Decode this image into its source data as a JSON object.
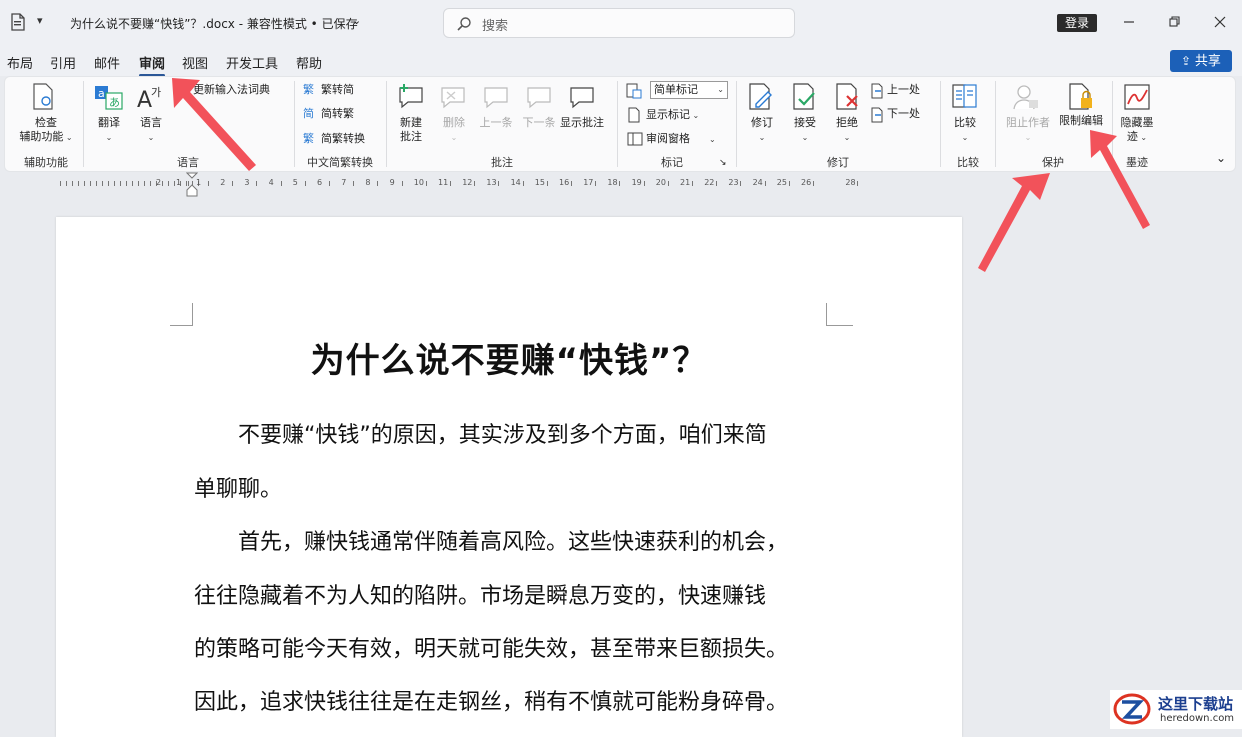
{
  "titlebar": {
    "doc_title": "为什么说不要赚“快钱”？.docx  -  兼容性模式 • 已保存",
    "search_placeholder": "搜索",
    "login_label": "登录"
  },
  "menu": {
    "tabs": [
      "布局",
      "引用",
      "邮件",
      "审阅",
      "视图",
      "开发工具",
      "帮助"
    ],
    "active": "审阅",
    "share_label": "共享"
  },
  "ribbon": {
    "groups": {
      "accessibility": "辅助功能",
      "language": "语言",
      "chinese_conv": "中文简繁转换",
      "comments": "批注",
      "tracking": "标记",
      "changes": "修订",
      "compare": "比较",
      "protect": "保护",
      "ink": "墨迹"
    },
    "buttons": {
      "check_line1": "检查",
      "check_line2": "辅助功能",
      "translate": "翻译",
      "language": "语言",
      "update_ime": "更新输入法词典",
      "trad_to_simp": "繁转简",
      "simp_to_trad": "简转繁",
      "conv": "简繁转换",
      "new_comment_1": "新建",
      "new_comment_2": "批注",
      "delete": "删除",
      "prev": "上一条",
      "next": "下一条",
      "show_comments": "显示批注",
      "simple_markup": "简单标记",
      "show_markup": "显示标记",
      "review_pane": "审阅窗格",
      "track": "修订",
      "accept": "接受",
      "reject": "拒绝",
      "prev_change": "上一处",
      "next_change": "下一处",
      "compare": "比较",
      "block_authors": "阻止作者",
      "restrict_editing": "限制编辑",
      "hide_ink_1": "隐藏墨",
      "hide_ink_2": "迹"
    }
  },
  "ruler": {
    "numbers": [
      "2",
      "1",
      "1",
      "2",
      "3",
      "4",
      "5",
      "6",
      "7",
      "8",
      "9",
      "10",
      "11",
      "12",
      "13",
      "14",
      "15",
      "16",
      "17",
      "18",
      "19",
      "20",
      "21",
      "22",
      "23",
      "24",
      "25",
      "26",
      "28"
    ]
  },
  "document": {
    "heading": "为什么说不要赚“快钱”？",
    "lines": [
      "　　不要赚“快钱”的原因，其实涉及到多个方面，咱们来简",
      "单聊聊。",
      "　　首先，赚快钱通常伴随着高风险。这些快速获利的机会，",
      "往往隐藏着不为人知的陷阱。市场是瞬息万变的，快速赚钱",
      "的策略可能今天有效，明天就可能失效，甚至带来巨额损失。",
      "因此，追求快钱往往是在走钢丝，稍有不慎就可能粉身碎骨。"
    ]
  },
  "watermark": {
    "cn": "这里下载站",
    "en": "heredown.com"
  },
  "colors": {
    "accent": "#2b5797",
    "share": "#1c60b8",
    "arrow": "#f2525a"
  }
}
